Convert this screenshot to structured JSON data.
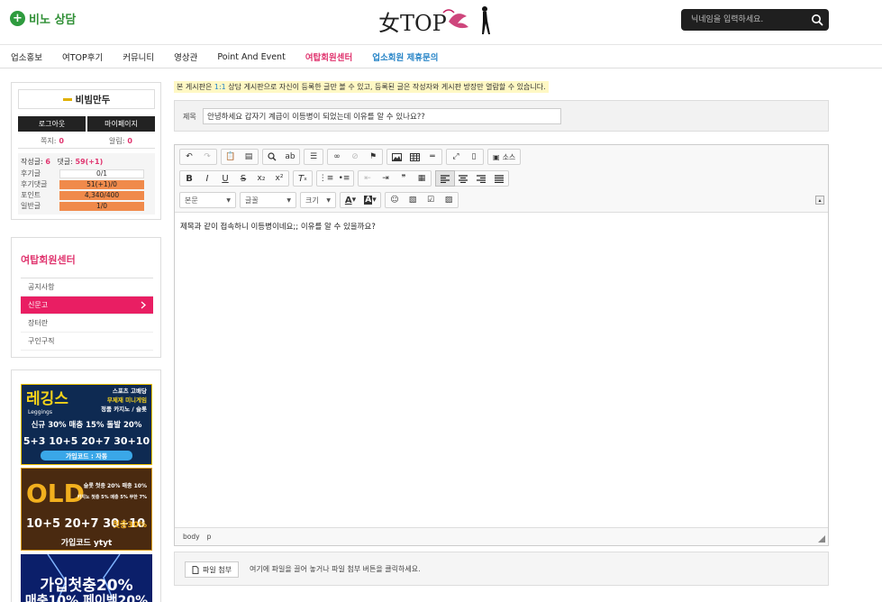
{
  "header": {
    "brand_logo": "비노 상담",
    "center_logo": "女TOP",
    "search_placeholder": "닉네임을 입력하세요."
  },
  "nav": {
    "items": [
      "업소홍보",
      "여TOP후기",
      "커뮤니티",
      "영상관",
      "Point And Event",
      "여탑회원센터",
      "업소회원 제휴문의"
    ],
    "pink_item": "여탑회원센터",
    "blue_item": "업소회원 제휴문의"
  },
  "profile": {
    "nickname": "비빔만두",
    "logout": "로그아웃",
    "mypage": "마이페이지",
    "memo_label": "쪽지:",
    "memo_count": "0",
    "alert_label": "알림:",
    "alert_count": "0",
    "posts_label": "작성글:",
    "posts_count": "6",
    "comments_label": "댓글:",
    "comments_count": "59(+1)",
    "stats": [
      {
        "label": "후기글",
        "value": "0/1"
      },
      {
        "label": "후기댓글",
        "value": "51(+1)/0"
      },
      {
        "label": "포인트",
        "value": "4,340/400"
      },
      {
        "label": "일반글",
        "value": "1/0"
      }
    ]
  },
  "member_menu": {
    "title": "여탑회원센터",
    "items": [
      "공지사항",
      "신문고",
      "장터란",
      "구인구직"
    ],
    "active_index": 1
  },
  "banners": {
    "leggings": {
      "title": "레깅스",
      "sub": "Leggings",
      "right1": "스포츠 고배당",
      "right2": "무제재 미니게임",
      "right3": "정품 카지노 / 슬롯",
      "line": "신규 30% 매충 15% 돌발 20%",
      "numbers": "5+3 10+5 20+7 30+10",
      "code": "가입코드 : 자동"
    },
    "old": {
      "title": "OLD",
      "right": "슬롯 첫충 20% 매충 10%",
      "right2": "카지노 첫충 5% 매충 5% 무한 7%",
      "numbers": "10+5 20+7 30+10",
      "right3": "첫충30%",
      "code": "가입코드 ytyt"
    },
    "third": {
      "line1": "가입첫충20%",
      "line2": "매충10% 페이백20%"
    }
  },
  "notice": {
    "pre": "본 게시판은 ",
    "highlight": "1:1",
    "post": " 상담 게시판으로 자신이 등록한 글만 볼 수 있고, 등록된 글은 작성자와 게시판 방장만 열람할 수 있습니다."
  },
  "form": {
    "title_label": "제목",
    "title_value": "안녕하세요 갑자기 계급이 이등병이 되었는데 이유를 알 수 있나요??"
  },
  "editor": {
    "source_label": "소스",
    "format_combo": "본문",
    "font_combo": "글꼴",
    "size_combo": "크기",
    "body_text": "제목과 같이 접속하니 이등병이네요;; 이유를 알 수 있을까요?",
    "path": [
      "body",
      "p"
    ]
  },
  "file_upload": {
    "button_label": "파일 첨부",
    "hint": "여기에 파일을 끌어 놓거나 파일 첨부 버튼을 클릭하세요."
  }
}
